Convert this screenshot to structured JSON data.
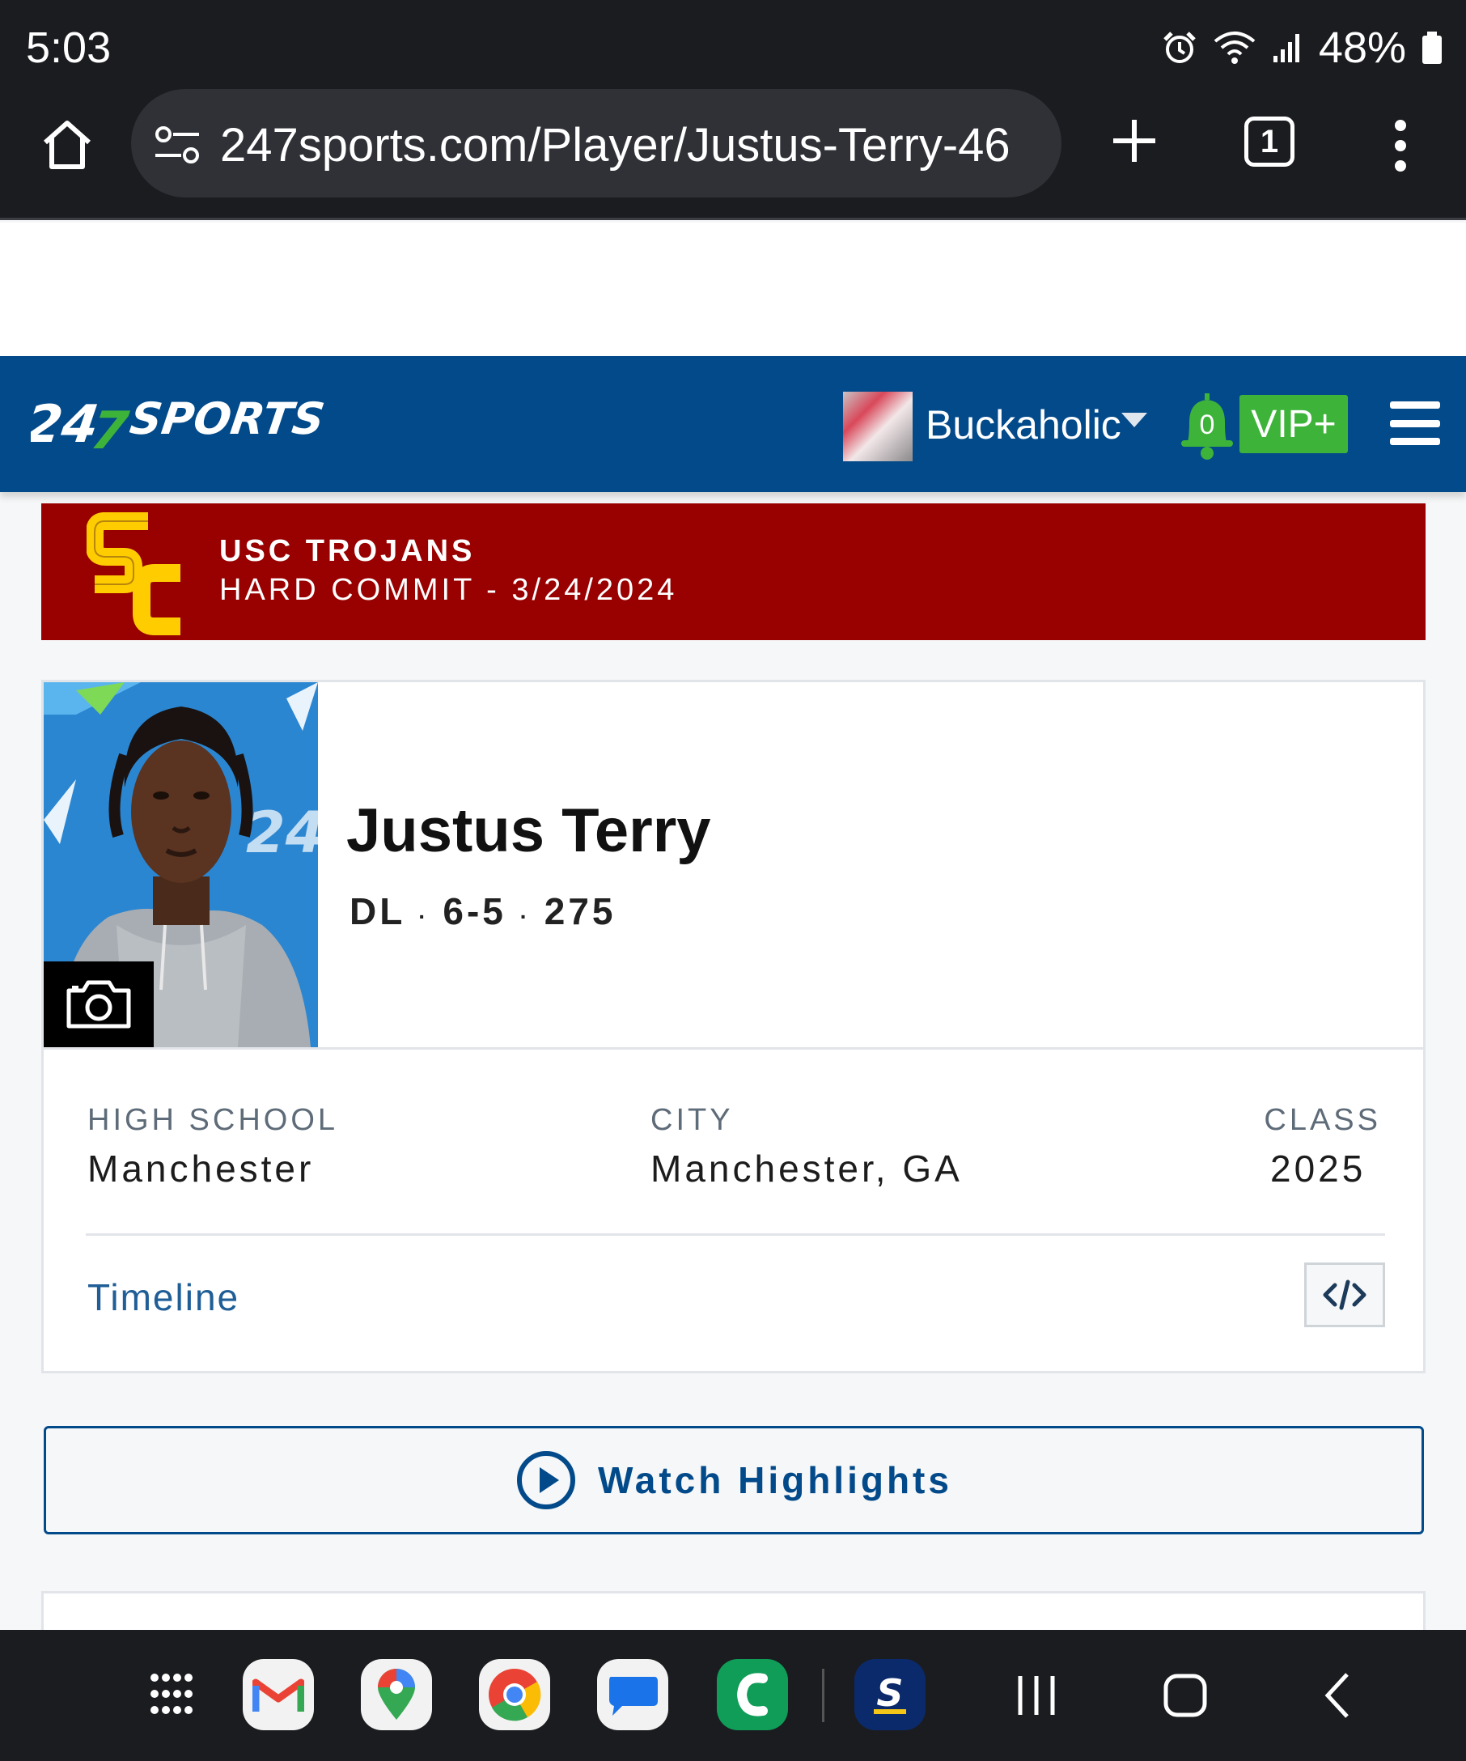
{
  "status_bar": {
    "time": "5:03",
    "battery": "48%",
    "icons": [
      "alarm-icon",
      "wifi-icon",
      "signal-icon",
      "battery-icon"
    ]
  },
  "browser": {
    "url": "247sports.com/Player/Justus-Terry-46",
    "tab_count": "1",
    "icons": [
      "home-icon",
      "site-settings-icon",
      "plus-icon",
      "tab-switcher-icon",
      "more-vert-icon"
    ]
  },
  "site_header": {
    "logo_text": "247SPORTS",
    "username": "Buckaholic",
    "notification_count": "0",
    "vip_label": "VIP+",
    "colors": {
      "header_bg": "#034a8a",
      "logo_green": "#3eb33a",
      "vip_green": "#3eb33a"
    }
  },
  "commit": {
    "school": "USC TROJANS",
    "status": "HARD COMMIT - 3/24/2024",
    "colors": {
      "banner_bg": "#990000",
      "logo_gold": "#ffcc00"
    }
  },
  "player": {
    "name": "Justus Terry",
    "position": "DL",
    "height": "6-5",
    "weight": "275",
    "separator": "·",
    "info": [
      {
        "label": "HIGH SCHOOL",
        "value": "Manchester"
      },
      {
        "label": "CITY",
        "value": "Manchester, GA"
      },
      {
        "label": "CLASS",
        "value": "2025"
      }
    ],
    "timeline_link": "Timeline",
    "embed_label": "</>"
  },
  "highlights": {
    "label": "Watch Highlights"
  },
  "nav_bar": {
    "apps": [
      "apps-grid-icon",
      "gmail-icon",
      "maps-icon",
      "chrome-icon",
      "messages-icon",
      "phone-app-icon",
      "sports-app-icon"
    ],
    "buttons": [
      "recents-icon",
      "home-nav-icon",
      "back-icon"
    ]
  }
}
